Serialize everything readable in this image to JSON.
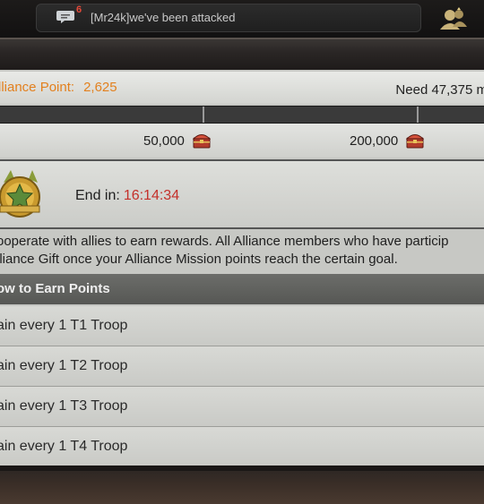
{
  "chat": {
    "badge_count": "6",
    "message": "[Mr24k]we've been attacked"
  },
  "points": {
    "label": "lliance Point:",
    "value": "2,625",
    "need": "Need 47,375 m"
  },
  "milestones": [
    {
      "value": "50,000"
    },
    {
      "value": "200,000"
    }
  ],
  "timer": {
    "label": "End in:",
    "value": "16:14:34"
  },
  "description": {
    "line1": "ooperate with allies to earn rewards. All Alliance members who have particip",
    "line2": "lliance Gift once your Alliance Mission points reach the certain goal."
  },
  "earn": {
    "title": "ow to Earn Points",
    "items": [
      {
        "label": "ain every 1 T1 Troop"
      },
      {
        "label": "ain every 1 T2 Troop"
      },
      {
        "label": "ain every 1 T3 Troop"
      },
      {
        "label": "ain every 1 T4 Troop"
      }
    ]
  },
  "colors": {
    "accent_orange": "#e2801e",
    "timer_red": "#c4302a",
    "badge_red": "#e64a3a"
  },
  "icons": {
    "chat": "chat-bubble-icon",
    "friends": "friends-icon",
    "chest": "treasure-chest-icon",
    "medal": "alliance-medal-icon"
  }
}
